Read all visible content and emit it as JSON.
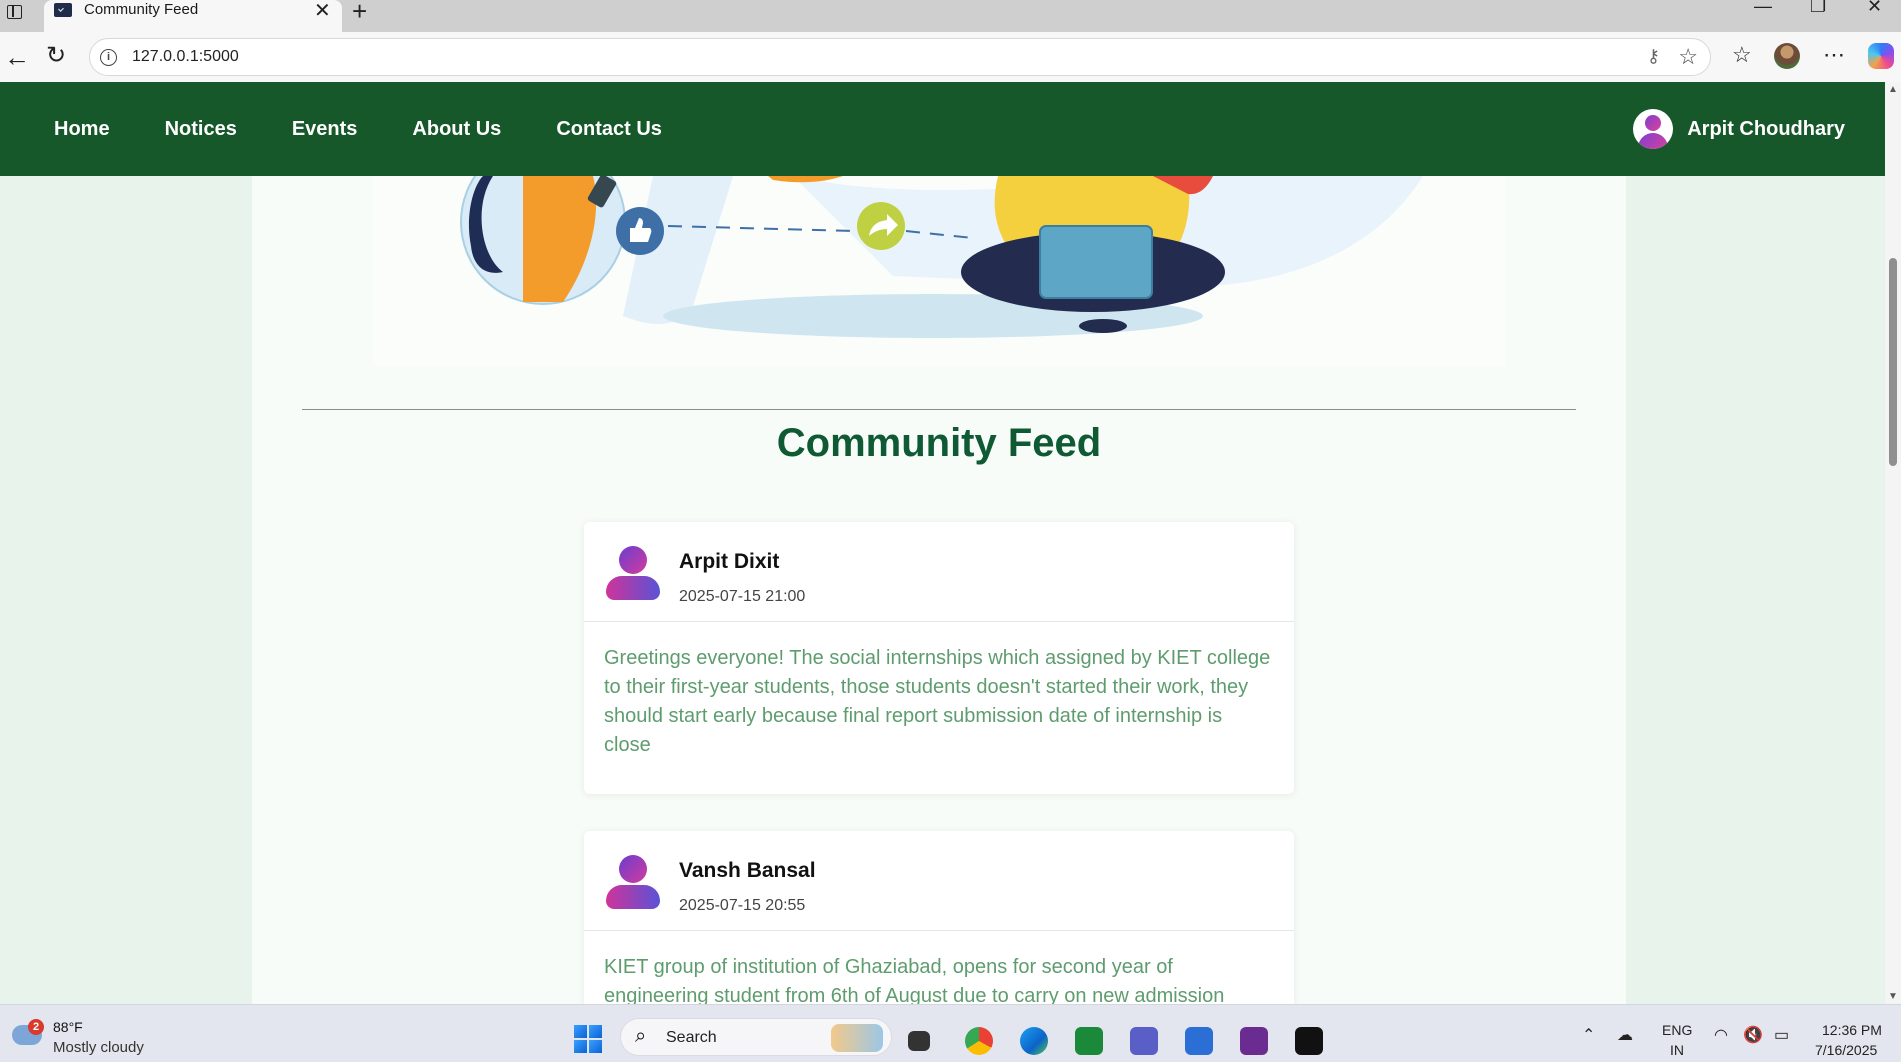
{
  "browser": {
    "tab_title": "Community Feed",
    "url": "127.0.0.1:5000",
    "new_tab_symbol": "+",
    "close_tab_symbol": "✕",
    "window_controls": {
      "minimize": "—",
      "maximize": "❐",
      "close": "✕"
    },
    "icons": [
      "sidebar-icon",
      "back-icon",
      "reload-icon",
      "info-icon",
      "key-icon",
      "star-icon",
      "favorites-icon",
      "profile-avatar",
      "more-icon",
      "copilot-icon"
    ]
  },
  "navbar": {
    "links": [
      "Home",
      "Notices",
      "Events",
      "About Us",
      "Contact Us"
    ],
    "user_name": "Arpit Choudhary",
    "bg_color": "#16582a"
  },
  "feed": {
    "title": "Community Feed",
    "title_color": "#0f5a34",
    "posts": [
      {
        "author": "Arpit Dixit",
        "timestamp": "2025-07-15 21:00",
        "content": "Greetings everyone! The social internships which assigned by KIET college to their first-year students, those students doesn't started their work, they should start early because final report submission date of internship is close"
      },
      {
        "author": "Vansh Bansal",
        "timestamp": "2025-07-15 20:55",
        "content": "KIET group of institution of Ghaziabad, opens for second year of engineering student from 6th of August due to carry on new admission"
      }
    ]
  },
  "taskbar": {
    "weather_alerts": "2",
    "weather_temp": "88°F",
    "weather_desc": "Mostly cloudy",
    "search_label": "Search",
    "lang_line1": "ENG",
    "lang_line2": "IN",
    "time": "12:36 PM",
    "date": "7/16/2025"
  }
}
